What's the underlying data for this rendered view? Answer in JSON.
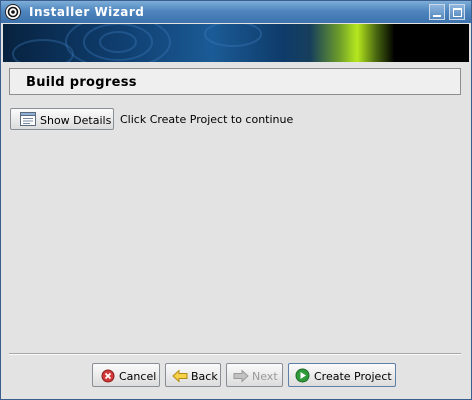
{
  "window": {
    "title": "Installer Wizard"
  },
  "colors": {
    "titlebar": "#4f86bf",
    "window_bg": "#e3e3e3",
    "banner_accent": "#b6e81e"
  },
  "icons": {
    "app": "app-logo-icon",
    "minimize": "minimize-icon",
    "maximize": "maximize-icon",
    "details": "document-icon",
    "cancel": "cancel-icon",
    "back": "arrow-left-icon",
    "next": "arrow-right-icon",
    "create": "play-icon"
  },
  "header": {
    "title": "Build progress"
  },
  "main": {
    "details_button": "Show Details",
    "status": "Click Create Project to continue"
  },
  "footer": {
    "cancel": "Cancel",
    "back": "Back",
    "next": "Next",
    "create": "Create Project"
  }
}
